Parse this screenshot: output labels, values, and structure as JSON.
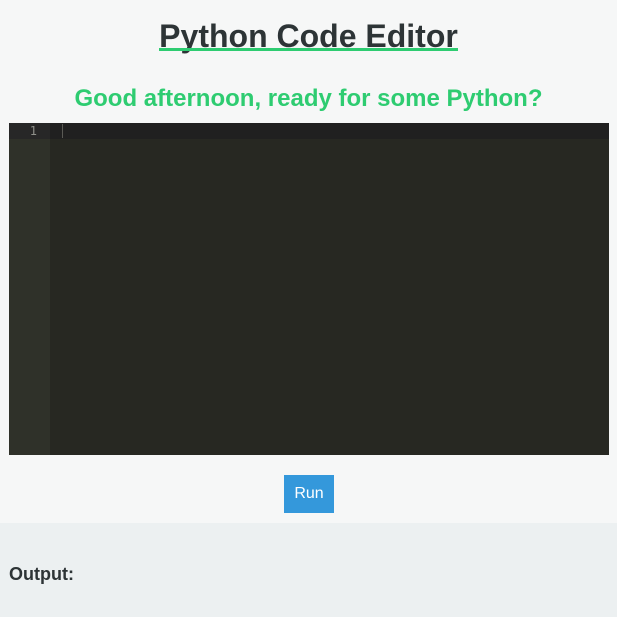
{
  "header": {
    "title": "Python Code Editor",
    "greeting": "Good afternoon, ready for some Python?"
  },
  "editor": {
    "line_numbers": [
      "1"
    ],
    "code": "",
    "theme": "monokai"
  },
  "toolbar": {
    "run_label": "Run"
  },
  "output": {
    "label": "Output:",
    "content": ""
  },
  "colors": {
    "accent_green": "#2ecc71",
    "button_blue": "#3498db",
    "title_text": "#2d3436",
    "editor_bg": "#272822",
    "gutter_bg": "#2f3129",
    "output_bg": "#ecf0f1"
  }
}
